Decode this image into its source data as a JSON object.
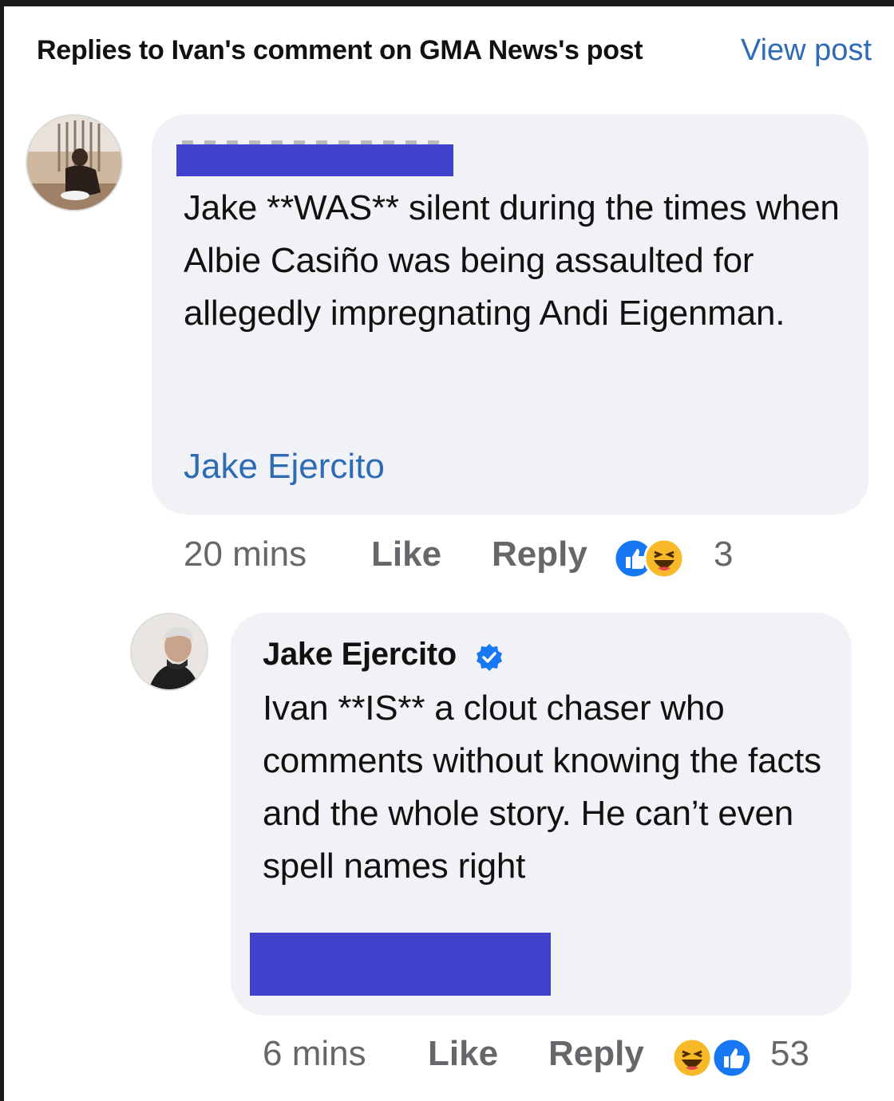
{
  "header": {
    "title": "Replies to Ivan's comment on GMA News's post",
    "view_post": "View post"
  },
  "colors": {
    "link": "#2d6bb8",
    "bubble": "#f0f2f5",
    "meta": "#65676b",
    "redaction": "#4042cc",
    "like_blue": "#1877f2",
    "haha_yellow": "#f7b928"
  },
  "comments": [
    {
      "text": "Jake **WAS** silent during the times when Albie Casiño was being assaulted for allegedly impregnating Andi Eigenman.",
      "mention": "Jake Ejercito",
      "time": "20 mins",
      "like_label": "Like",
      "reply_label": "Reply",
      "reactions": [
        "like-icon",
        "haha-icon"
      ],
      "reaction_count": "3"
    },
    {
      "author": "Jake Ejercito",
      "verified": true,
      "text": "Ivan **IS** a clout chaser who comments without knowing the facts and the whole story. He can’t even spell names right",
      "time": "6 mins",
      "like_label": "Like",
      "reply_label": "Reply",
      "reactions": [
        "haha-icon",
        "like-icon"
      ],
      "reaction_count": "53"
    }
  ]
}
